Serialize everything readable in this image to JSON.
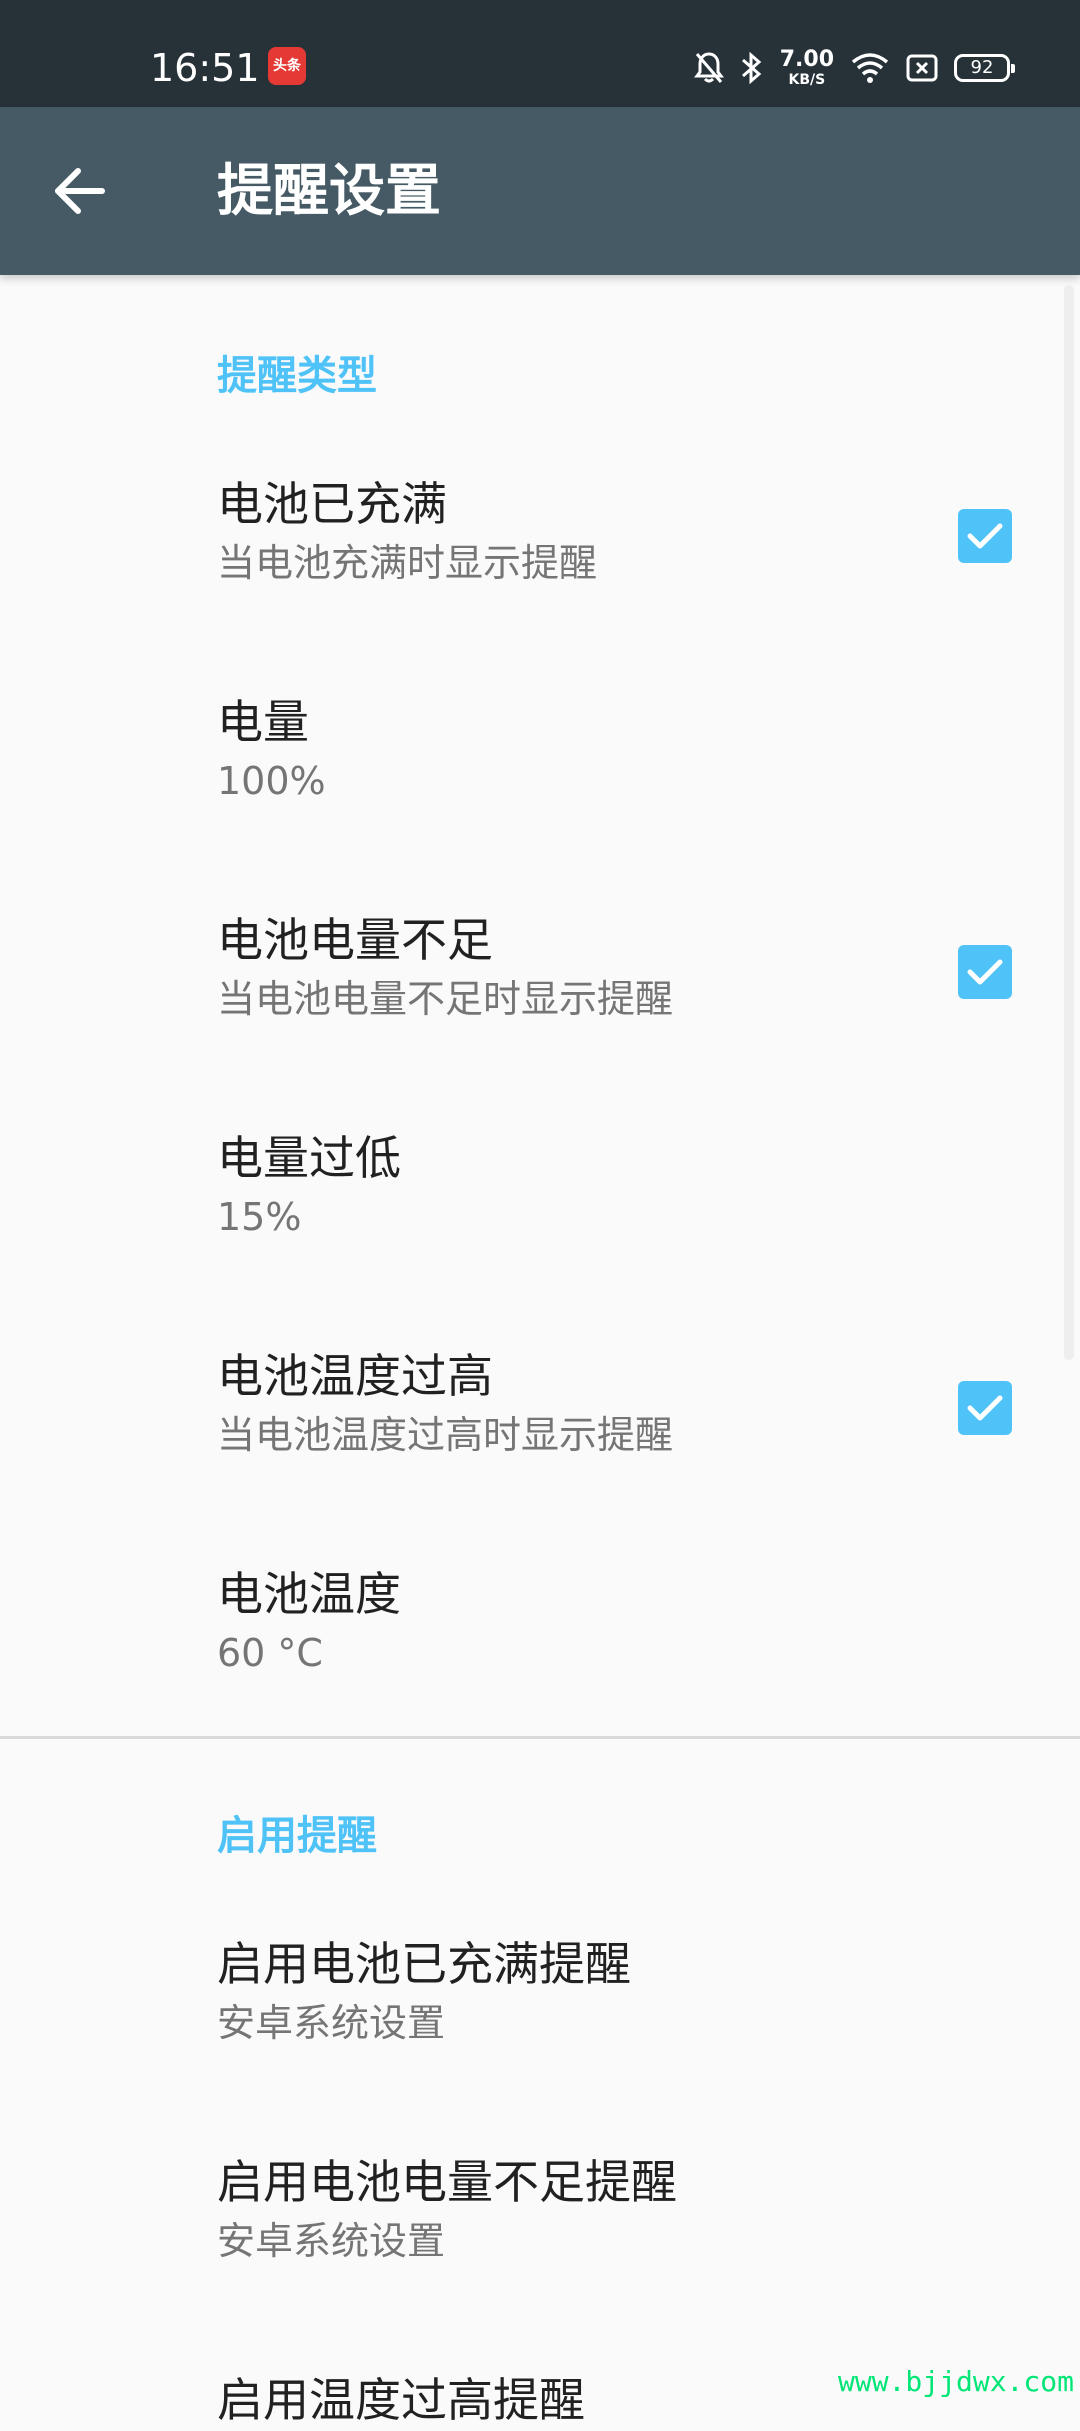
{
  "status_bar": {
    "time": "16:51",
    "app_badge": "头条",
    "speed_value": "7.00",
    "speed_unit": "KB/S",
    "battery_level": "92"
  },
  "toolbar": {
    "title": "提醒设置"
  },
  "sections": [
    {
      "header": "提醒类型",
      "items": [
        {
          "title": "电池已充满",
          "summary": "当电池充满时显示提醒",
          "checked": true
        },
        {
          "title": "电量",
          "summary": "100%"
        },
        {
          "title": "电池电量不足",
          "summary": "当电池电量不足时显示提醒",
          "checked": true
        },
        {
          "title": "电量过低",
          "summary": "15%"
        },
        {
          "title": "电池温度过高",
          "summary": "当电池温度过高时显示提醒",
          "checked": true
        },
        {
          "title": "电池温度",
          "summary": "60 °C"
        }
      ]
    },
    {
      "header": "启用提醒",
      "items": [
        {
          "title": "启用电池已充满提醒",
          "summary": "安卓系统设置"
        },
        {
          "title": "启用电池电量不足提醒",
          "summary": "安卓系统设置"
        },
        {
          "title": "启用温度过高提醒"
        }
      ]
    }
  ],
  "watermark": "www.bjjdwx.com",
  "colors": {
    "status_bar": "#263238",
    "toolbar": "#455a64",
    "accent": "#4fc3f7"
  }
}
